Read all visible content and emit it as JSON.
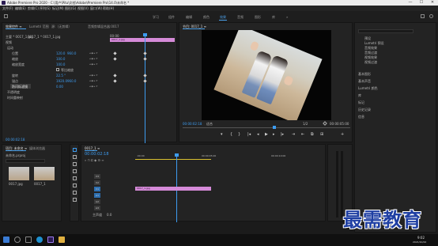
{
  "window": {
    "title": "Adobe Premiere Pro 2020 - C:\\用户\\Pitu\\文档\\Adobe\\Premiere Pro\\14.0\\未命名 *",
    "controls": [
      "—",
      "☐",
      "✕"
    ]
  },
  "menu": [
    "文件(F)",
    "编辑(E)",
    "剪辑(C)",
    "序列(S)",
    "标记(M)",
    "图形(G)",
    "视图(V)",
    "窗口(W)",
    "帮助(H)"
  ],
  "workspaces": [
    "学习",
    "组件",
    "编辑",
    "颜色",
    "效果",
    "音频",
    "图形",
    "库",
    "»"
  ],
  "workspace_active": "效果",
  "effect_controls": {
    "tabs": [
      "效果控件 ≡",
      "Lumetri 范围",
      "源:（无剪辑）",
      "音频剪辑混合器:0017"
    ],
    "source": "主要 * 0017_1.jpg",
    "clip": "0017_1 * 0017_1.jpg",
    "ruler_start": "00:00",
    "clip_bar": "0017_1.jpg",
    "video_header": "视频",
    "motion": "运动",
    "position": "位置",
    "position_x": "120.0",
    "position_y": "960.0",
    "scale": "缩放",
    "scale_val": "100.0",
    "scale_width": "缩放宽度",
    "scale_width_val": "100.0",
    "uniform": "等比缩放",
    "rotation": "旋转",
    "rotation_val": "22.5 °",
    "anchor": "锚点",
    "anchor_x": "1920.0",
    "anchor_y": "960.0",
    "flicker": "防闪烁滤镜",
    "flicker_val": "0.00",
    "opacity": "不透明度",
    "time_remap": "时间重映射",
    "timecode": "00:00:02:18"
  },
  "program": {
    "tab": "节目: 0017_1 ≡",
    "timecode": "00:00:02:18",
    "fit": "适合",
    "fraction": "1/2",
    "duration": "00:00:05:00",
    "controls": [
      "▾",
      "{",
      "}",
      "|◂",
      "◂|",
      "◂",
      "▶",
      "▸",
      "|▸",
      "⇥",
      "⇤",
      "⧉",
      "⊞",
      "+"
    ]
  },
  "effects_panel": {
    "items": [
      "预设",
      "Lumetri 预设",
      "音频效果",
      "音频过渡",
      "视频效果",
      "视频过渡"
    ],
    "sections": [
      "基本图形",
      "基本声音",
      "Lumetri 颜色",
      "库",
      "标记",
      "历史记录",
      "信息"
    ]
  },
  "project": {
    "tabs": [
      "项目: 未命名 ≡",
      "媒体浏览器"
    ],
    "name": "未命名.prproj",
    "thumb_label_1": "0017.jpg",
    "thumb_label_2": "0017_1"
  },
  "timeline": {
    "tab": "0017_1 ≡",
    "timecode": "00:00:02:18",
    "ruler": [
      ":00:00",
      "00:00:05:00",
      "00:00:10:00"
    ],
    "tracks_video": [
      "V3",
      "V2",
      "V1"
    ],
    "tracks_audio": [
      "A1",
      "A2",
      "A3"
    ],
    "master": "主声道",
    "master_val": "0.0",
    "clip": "0017_1.jpg"
  },
  "taskbar": {
    "time": "9:02",
    "date": "2021/10/22"
  },
  "watermark": "最需教育",
  "colors": {
    "accent": "#3d9cf0",
    "clip": "#d58ad8"
  }
}
